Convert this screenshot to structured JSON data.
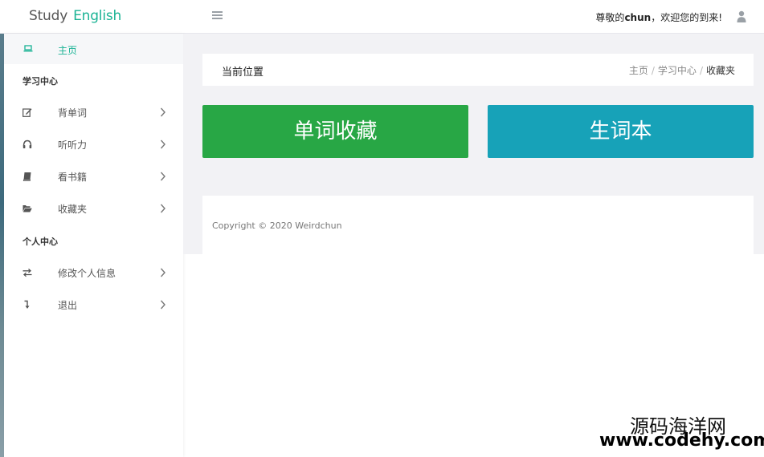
{
  "header": {
    "logo_word1": "Study",
    "logo_word2": "English",
    "welcome_prefix": "尊敬的",
    "welcome_user": "chun",
    "welcome_suffix": "，欢迎您的到来!",
    "menu_icon": "hamburger-icon",
    "user_icon": "user-icon"
  },
  "sidebar": {
    "home": {
      "label": "主页",
      "icon": "laptop-icon"
    },
    "section_study": "学习中心",
    "study_items": [
      {
        "label": "背单词",
        "icon": "edit-icon"
      },
      {
        "label": "听听力",
        "icon": "headphones-icon"
      },
      {
        "label": "看书籍",
        "icon": "book-icon"
      },
      {
        "label": "收藏夹",
        "icon": "folder-open-icon"
      }
    ],
    "section_personal": "个人中心",
    "personal_items": [
      {
        "label": "修改个人信息",
        "icon": "exchange-icon"
      },
      {
        "label": "退出",
        "icon": "level-down-icon"
      }
    ]
  },
  "content": {
    "breadcrumb_title": "当前位置",
    "breadcrumbs": [
      "主页",
      "学习中心",
      "收藏夹"
    ],
    "button_words": "单词收藏",
    "button_vocab": "生词本",
    "copyright": "Copyright © 2020 Weirdchun"
  },
  "watermark": {
    "line1": "源码海洋网",
    "line2": "www.codehy.com"
  },
  "colors": {
    "accent": "#1ab394",
    "green_button": "#28a745",
    "teal_button": "#17a2b8",
    "content_bg": "#f2f2f5"
  }
}
